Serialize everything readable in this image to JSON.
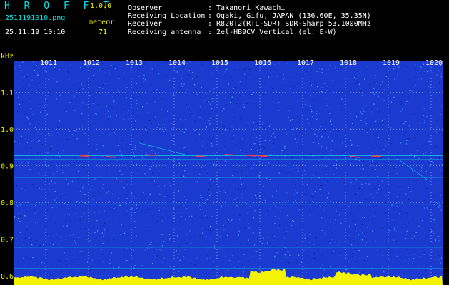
{
  "header": {
    "app_name": "H R O F F T",
    "version": "1.0.0",
    "filename": "2511191010.png",
    "datetime": "25.11.19 10:10",
    "meteor_label": "meteor",
    "meteor_count": "71",
    "info": [
      {
        "label": "Observer",
        "value": ": Takanori Kawachi"
      },
      {
        "label": "Receiving Location",
        "value": ": Ogaki, Gifu, JAPAN (136.60E, 35.35N)"
      },
      {
        "label": "Receiver",
        "value": ": R820T2(RTL-SDR) SDR-Sharp 53.1000MHz"
      },
      {
        "label": "Receiving antenna",
        "value": ": 2el-HB9CV Vertical (el. E-W)"
      }
    ]
  },
  "spectrogram": {
    "y_unit": "kHz",
    "y_ticks": [
      "1.1",
      "1.0",
      "0.9",
      "0.8",
      "0.7",
      "0.6"
    ],
    "y_tick_values": [
      1.1,
      1.0,
      0.9,
      0.8,
      0.7,
      0.6
    ],
    "x_ticks": [
      "1011",
      "1012",
      "1013",
      "1014",
      "1015",
      "1016",
      "1017",
      "1018",
      "1019",
      "1020"
    ],
    "y_range": [
      0.575,
      1.185
    ],
    "colors": {
      "background": "#1a3ad0",
      "grid": "#ffffff",
      "tick_label": "#f4f400",
      "signal": "#00e8e8",
      "power": "#f4f400"
    }
  }
}
